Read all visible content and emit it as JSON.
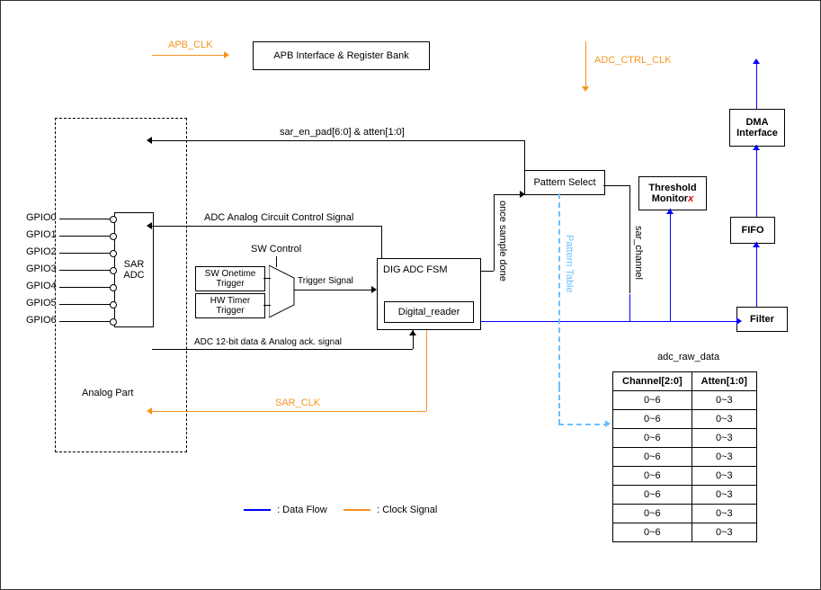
{
  "topblock": {
    "apb": "APB Interface & Register Bank"
  },
  "clocks": {
    "apb_clk": "APB_CLK",
    "adc_ctrl_clk": "ADC_CTRL_CLK",
    "sar_clk": "SAR_CLK"
  },
  "analog": {
    "gpio": [
      "GPIO0",
      "GPIO1",
      "GPIO2",
      "GPIO3",
      "GPIO4",
      "GPIO5",
      "GPIO6"
    ],
    "sar_adc": "SAR\nADC",
    "label": "Analog Part"
  },
  "blocks": {
    "sw_onetime": "SW Onetime\nTrigger",
    "hw_timer": "HW Timer\nTrigger",
    "sw_control": "SW Control",
    "trigger_signal": "Trigger Signal",
    "dig_fsm": "DIG ADC FSM",
    "digital_reader": "Digital_reader",
    "pattern_select": "Pattern Select",
    "threshold_monitor_prefix": "Threshold\nMonitor",
    "threshold_monitor_x": "x",
    "fifo": "FIFO",
    "filter": "Filter",
    "dma": "DMA\nInterface"
  },
  "signals": {
    "sar_en_pad": "sar_en_pad[6:0] & atten[1:0]",
    "adc_analog_ctrl": "ADC  Analog Circuit Control Signal",
    "adc_12bit": "ADC 12-bit data & Analog ack. signal",
    "once_sample_done": "once sample done",
    "sar_channel": "sar_channel",
    "adc_raw_data": "adc_raw_data",
    "pattern_table": "Pattern Table"
  },
  "legend": {
    "data_flow": ": Data Flow",
    "clock_signal": ": Clock Signal"
  },
  "table": {
    "headers": [
      "Channel[2:0]",
      "Atten[1:0]"
    ],
    "rows": [
      [
        "0~6",
        "0~3"
      ],
      [
        "0~6",
        "0~3"
      ],
      [
        "0~6",
        "0~3"
      ],
      [
        "0~6",
        "0~3"
      ],
      [
        "0~6",
        "0~3"
      ],
      [
        "0~6",
        "0~3"
      ],
      [
        "0~6",
        "0~3"
      ],
      [
        "0~6",
        "0~3"
      ]
    ]
  }
}
